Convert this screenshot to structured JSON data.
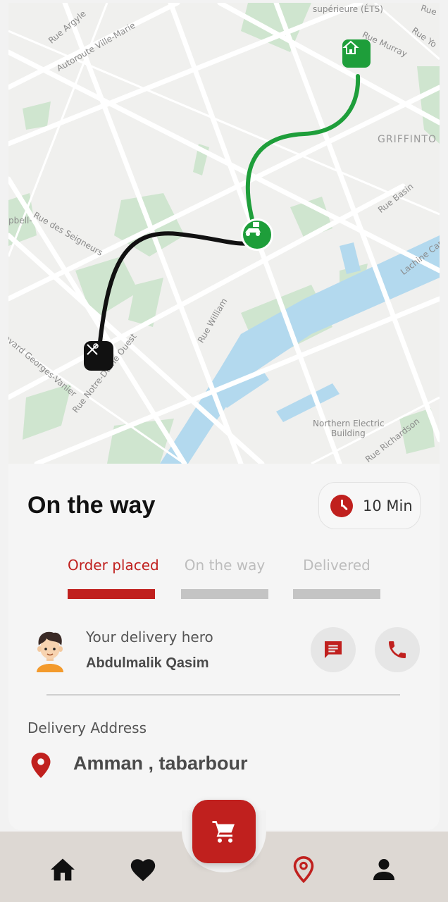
{
  "map": {
    "labels": {
      "ets": "supérieure (ÉTS)",
      "rue_top_right": "Rue",
      "rue_argyle": "Rue Argyle",
      "autoroute": "Autoroute Ville-Marie",
      "rue_murray": "Rue Murray",
      "rue_yo": "Rue Yo",
      "griffintown": "GRIFFINTO",
      "rue_basin": "Rue Basin",
      "lachine": "Lachine Can",
      "campbell": "pbell-",
      "seigneurs": "Rue des Seigneurs",
      "william": "Rue William",
      "georges": "evard Georges-Vanier",
      "notre_dame": "Rue Notre-Dame Ouest",
      "northern_electric": "Northern Electric",
      "building": "Building",
      "richardson": "Rue Richardson"
    },
    "icons": {
      "destination": "home-icon",
      "courier": "scooter-icon",
      "origin": "restaurant-icon"
    }
  },
  "sheet": {
    "status_title": "On the way",
    "eta": "10 Min",
    "steps": [
      {
        "label": "Order placed",
        "active": true
      },
      {
        "label": "On the way",
        "active": false
      },
      {
        "label": "Delivered",
        "active": false
      }
    ],
    "hero_caption": "Your delivery hero",
    "hero_name": "Abdulmalik Qasim",
    "address_label": "Delivery Address",
    "address_value": "Amman , tabarbour"
  },
  "nav": {
    "items": [
      "home-icon",
      "heart-icon",
      "cart-icon",
      "location-pin-icon",
      "person-icon"
    ]
  },
  "colors": {
    "accent": "#c0201e",
    "route_done": "#111111",
    "route_remaining": "#1e9e3a",
    "nav_background": "#ddd8d3"
  }
}
